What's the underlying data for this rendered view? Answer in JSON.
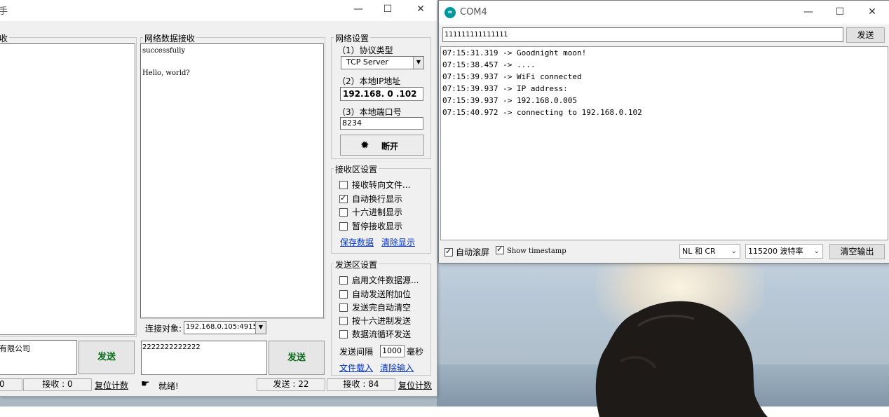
{
  "netAssistant": {
    "title_fragment": "手",
    "window_controls": {
      "minimize": "—",
      "maximize": "☐",
      "close": "✕"
    },
    "left_panel_legend_fragment": "收",
    "receive_panel": {
      "legend": "网络数据接收",
      "lines": [
        "successfully",
        "",
        "Hello, world?"
      ]
    },
    "net_settings": {
      "legend": "网络设置",
      "protocol_label": "（1）协议类型",
      "protocol_value": "TCP Server",
      "ip_label": "（2）本地IP地址",
      "ip_value": "192.168. 0 .102",
      "port_label": "（3）本地端口号",
      "port_value": "8234",
      "disconnect_label": "断开"
    },
    "recv_settings": {
      "legend": "接收区设置",
      "options": [
        {
          "label": "接收转向文件...",
          "checked": false
        },
        {
          "label": "自动换行显示",
          "checked": true
        },
        {
          "label": "十六进制显示",
          "checked": false
        },
        {
          "label": "暂停接收显示",
          "checked": false
        }
      ],
      "save_link": "保存数据",
      "clear_link": "清除显示"
    },
    "send_settings": {
      "legend": "发送区设置",
      "options": [
        {
          "label": "启用文件数据源...",
          "checked": false
        },
        {
          "label": "自动发送附加位",
          "checked": false
        },
        {
          "label": "发送完自动清空",
          "checked": false
        },
        {
          "label": "按十六进制发送",
          "checked": false
        },
        {
          "label": "数据流循环发送",
          "checked": false
        }
      ],
      "interval_label": "发送间隔",
      "interval_value": "1000",
      "interval_unit": "毫秒",
      "load_file_link": "文件载入",
      "clear_input_link": "清除输入"
    },
    "connection_target_label": "连接对象:",
    "connection_target_value": "192.168.0.105:4915",
    "left_send_text": "有限公司",
    "left_send_button": "发送",
    "main_send_text": "2222222222222",
    "main_send_button": "发送",
    "status": {
      "left_first": "0",
      "left_recv": "接收 : 0",
      "left_reset": "复位计数",
      "ready": "就绪!",
      "sent": "发送 : 22",
      "recv": "接收 : 84",
      "reset": "复位计数"
    }
  },
  "serialMonitor": {
    "title": "COM4",
    "logo_text": "∞",
    "window_controls": {
      "minimize": "—",
      "maximize": "☐",
      "close": "✕"
    },
    "input_value": "111111111111111",
    "send_button": "发送",
    "output_lines": [
      "07:15:31.319 -> Goodnight moon!",
      "07:15:38.457 -> ....",
      "07:15:39.937 -> WiFi connected",
      "07:15:39.937 -> IP address:",
      "07:15:39.937 -> 192.168.0.005",
      "07:15:40.972 -> connecting to 192.168.0.102"
    ],
    "autoscroll_label": "自动滚屏",
    "autoscroll_checked": true,
    "timestamp_label": "Show timestamp",
    "timestamp_checked": true,
    "line_ending": "NL 和 CR",
    "baud_rate": "115200 波特率",
    "clear_button": "清空输出"
  }
}
